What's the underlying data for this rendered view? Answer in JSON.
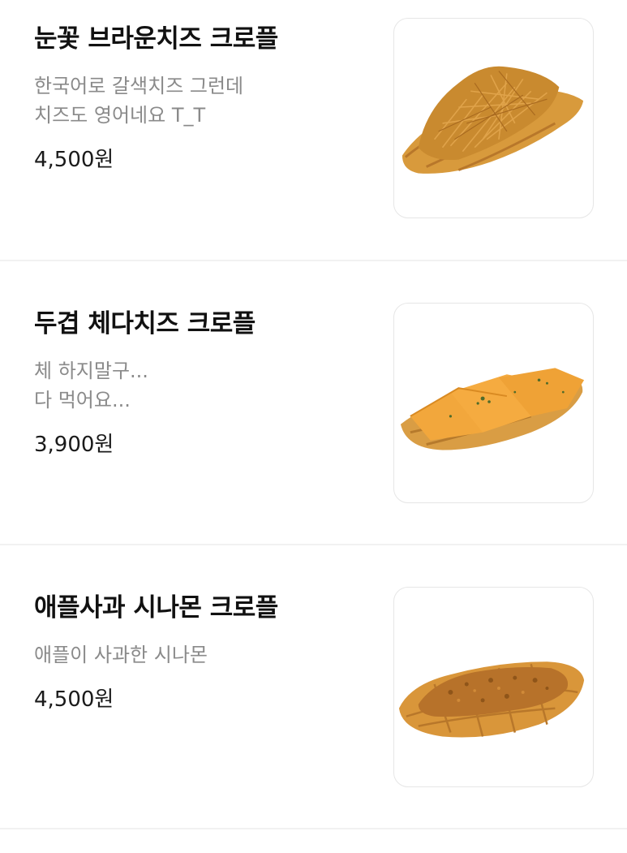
{
  "items": [
    {
      "name": "눈꽃 브라운치즈 크로플",
      "description": "한국어로 갈색치즈 그런데\n치즈도 영어네요 T_T",
      "price": "4,500원",
      "image": "croffle-brown-cheese-photo"
    },
    {
      "name": "두겹 체다치즈 크로플",
      "description": "체 하지말구...\n다 먹어요...",
      "price": "3,900원",
      "image": "croffle-cheddar-cheese-photo"
    },
    {
      "name": "애플사과 시나몬 크로플",
      "description": "애플이 사과한 시나몬",
      "price": "4,500원",
      "image": "croffle-apple-cinnamon-photo"
    }
  ],
  "colors": {
    "title": "#111111",
    "description": "#8a8a8a",
    "divider": "#f1f1f1",
    "thumb_border": "#e6e6e6"
  }
}
